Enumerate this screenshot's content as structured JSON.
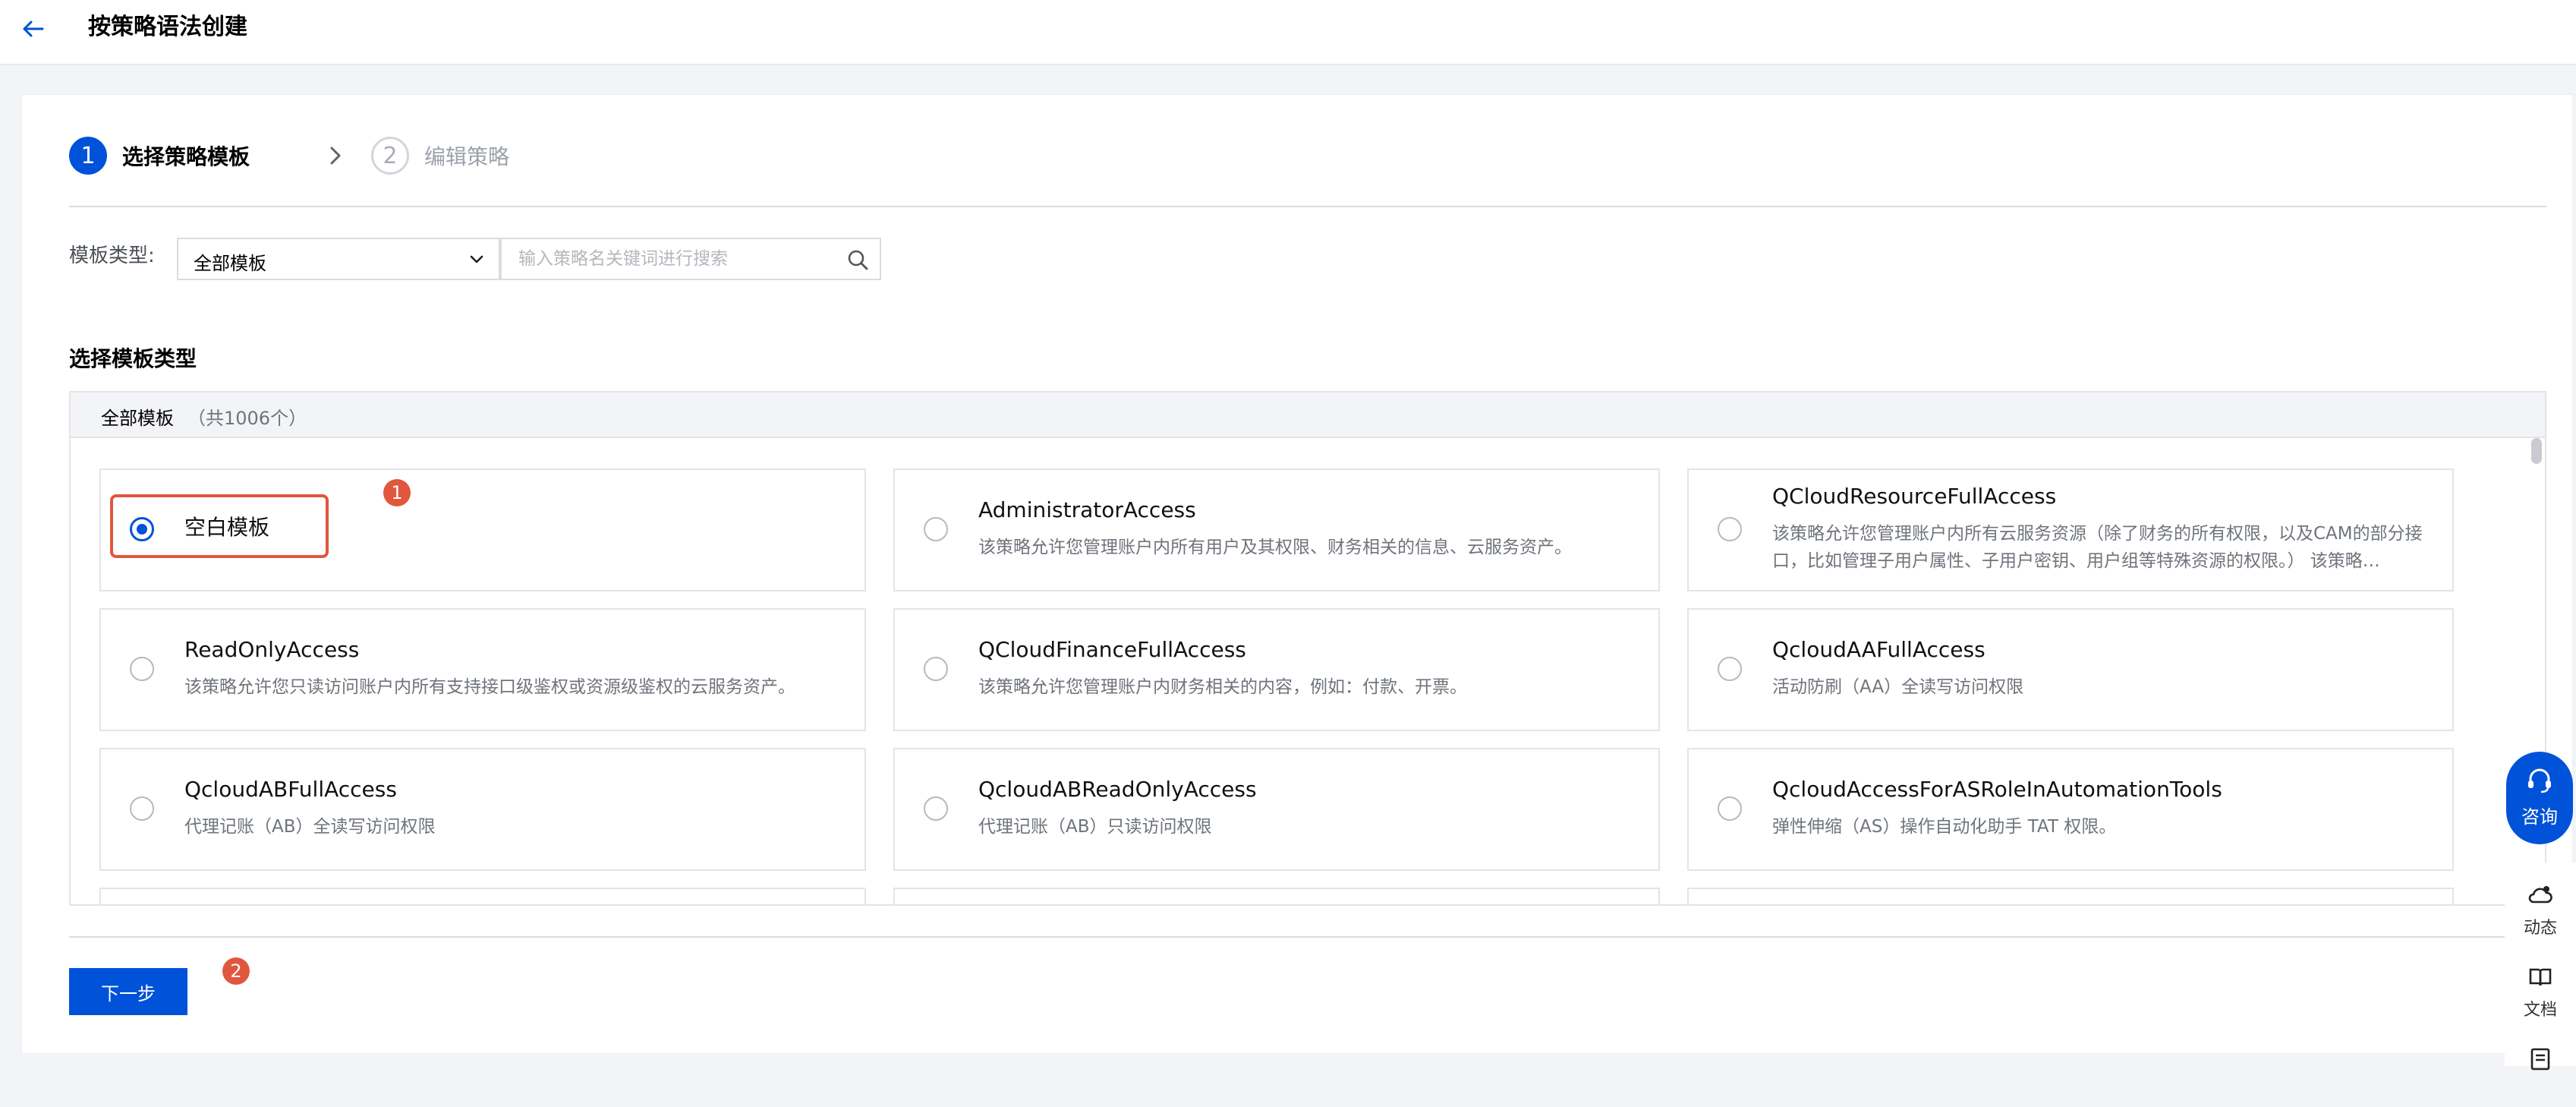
{
  "header": {
    "title": "按策略语法创建",
    "back_icon": "arrow-left-icon"
  },
  "steps": [
    {
      "number": "1",
      "label": "选择策略模板",
      "state": "active"
    },
    {
      "number": "2",
      "label": "编辑策略",
      "state": "inactive"
    }
  ],
  "filter": {
    "type_label": "模板类型:",
    "type_selected": "全部模板",
    "search_placeholder": "输入策略名关键词进行搜索",
    "search_value": ""
  },
  "section": {
    "title": "选择模板类型",
    "list_header_title": "全部模板",
    "list_header_count": "（共1006个）"
  },
  "templates": [
    {
      "name": "空白模板",
      "description": "",
      "selected": true
    },
    {
      "name": "AdministratorAccess",
      "description": "该策略允许您管理账户内所有用户及其权限、财务相关的信息、云服务资产。",
      "selected": false
    },
    {
      "name": "QCloudResourceFullAccess",
      "description": "该策略允许您管理账户内所有云服务资源（除了财务的所有权限，以及CAM的部分接口，比如管理子用户属性、子用户密钥、用户组等特殊资源的权限。） 该策略…",
      "selected": false
    },
    {
      "name": "ReadOnlyAccess",
      "description": "该策略允许您只读访问账户内所有支持接口级鉴权或资源级鉴权的云服务资产。",
      "selected": false
    },
    {
      "name": "QCloudFinanceFullAccess",
      "description": "该策略允许您管理账户内财务相关的内容，例如：付款、开票。",
      "selected": false
    },
    {
      "name": "QcloudAAFullAccess",
      "description": "活动防刷（AA）全读写访问权限",
      "selected": false
    },
    {
      "name": "QcloudABFullAccess",
      "description": "代理记账（AB）全读写访问权限",
      "selected": false
    },
    {
      "name": "QcloudABReadOnlyAccess",
      "description": "代理记账（AB）只读访问权限",
      "selected": false
    },
    {
      "name": "QcloudAccessForASRoleInAutomationTools",
      "description": "弹性伸缩（AS）操作自动化助手 TAT 权限。",
      "selected": false
    }
  ],
  "annotations": {
    "marker1": "1",
    "marker2": "2"
  },
  "actions": {
    "next_label": "下一步"
  },
  "floating": {
    "consult_label": "咨询",
    "tools": [
      {
        "label": "动态",
        "icon": "cloud-bell-icon"
      },
      {
        "label": "文档",
        "icon": "book-icon"
      },
      {
        "label": "",
        "icon": "form-icon"
      }
    ]
  },
  "colors": {
    "primary": "#0052d9",
    "annotation": "#e0573d"
  }
}
